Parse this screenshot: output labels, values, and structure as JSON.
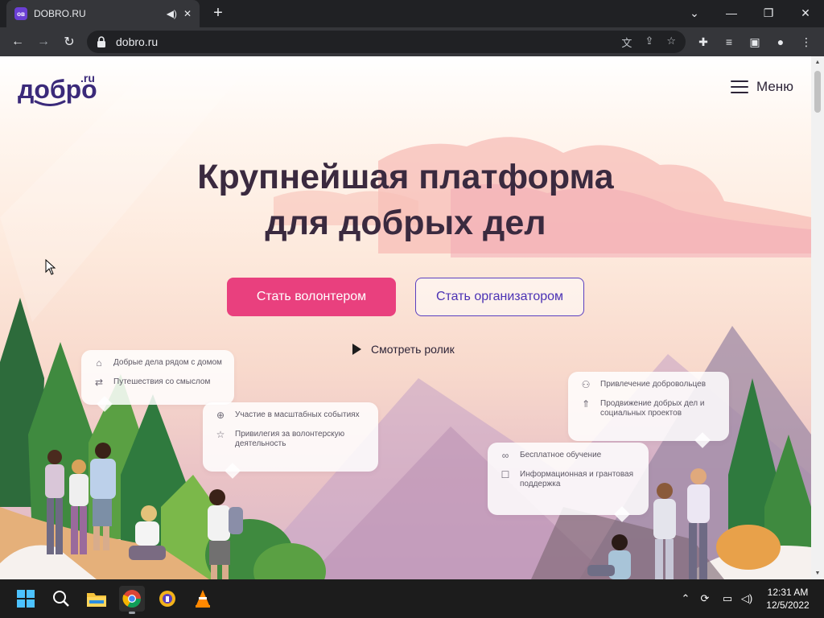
{
  "browser": {
    "tab_title": "DOBRO.RU",
    "favicon_text": "ов",
    "url": "dobro.ru",
    "window_controls": [
      "minimize",
      "restore",
      "close"
    ]
  },
  "site": {
    "logo_text": "добро",
    "logo_suffix": ".ru",
    "menu_label": "Меню",
    "headline_line1": "Крупнейшая платформа",
    "headline_line2": "для добрых дел",
    "primary_button": "Стать волонтером",
    "secondary_button": "Стать организатором",
    "video_link": "Смотреть ролик",
    "cards": [
      {
        "items": [
          {
            "icon": "home-icon",
            "text": "Добрые дела рядом с домом"
          },
          {
            "icon": "route-icon",
            "text": "Путешествия со смыслом"
          }
        ]
      },
      {
        "items": [
          {
            "icon": "globe-icon",
            "text": "Участие в масштабных событиях"
          },
          {
            "icon": "star-icon",
            "text": "Привилегия за волонтерскую деятельность"
          }
        ]
      },
      {
        "items": [
          {
            "icon": "people-icon",
            "text": "Привлечение добровольцев"
          },
          {
            "icon": "rocket-icon",
            "text": "Продвижение добрых дел и социальных проектов"
          }
        ]
      },
      {
        "items": [
          {
            "icon": "glasses-icon",
            "text": "Бесплатное обучение"
          },
          {
            "icon": "chat-icon",
            "text": "Информационная и грантовая поддержка"
          }
        ]
      }
    ],
    "colors": {
      "primary": "#e9407e",
      "outline": "#5a3fc0",
      "headline": "#3a2a3f"
    }
  },
  "taskbar": {
    "apps": [
      "start-icon",
      "search-icon",
      "file-explorer-icon",
      "chrome-icon",
      "vpn-icon",
      "vlc-icon"
    ],
    "time": "12:31 AM",
    "date": "12/5/2022"
  }
}
